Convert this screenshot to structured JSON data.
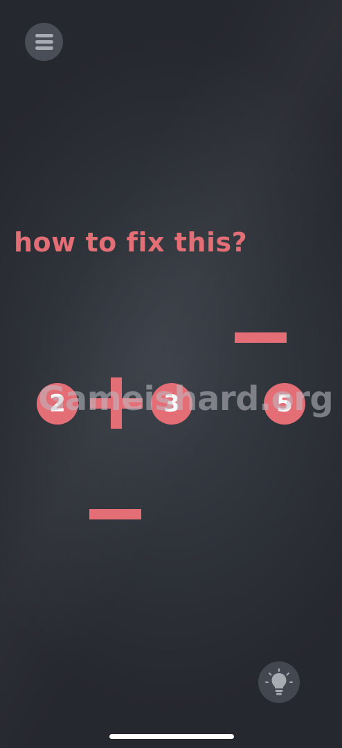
{
  "menu": {
    "icon": "hamburger-menu-icon"
  },
  "puzzle": {
    "prompt": "how to fix this?",
    "tokens": [
      "2",
      "3",
      "5"
    ],
    "sticks": [
      "horizontal",
      "vertical",
      "horizontal",
      "horizontal"
    ]
  },
  "watermark": {
    "text": "Gameishard.org"
  },
  "hint": {
    "icon": "lightbulb-icon"
  },
  "colors": {
    "accent": "#e36e76",
    "background": "#2f333a",
    "button_bg": "#4a4f57",
    "icon_gray": "#a7abb2"
  }
}
